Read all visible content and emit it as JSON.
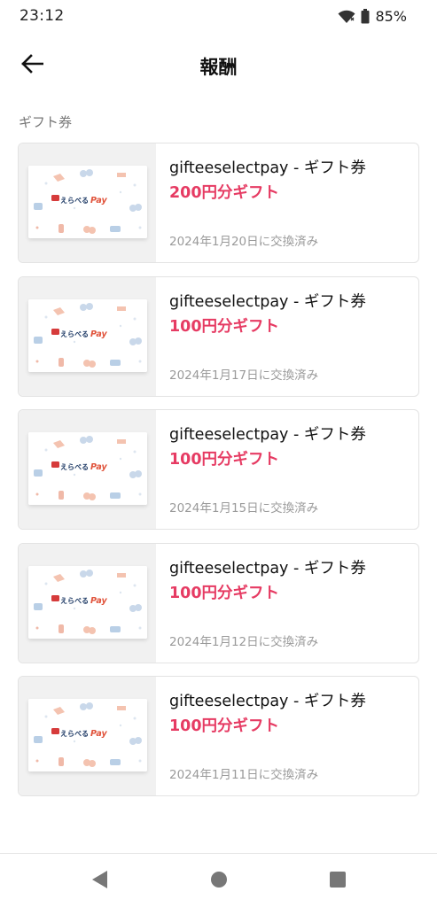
{
  "status_bar": {
    "time": "23:12",
    "battery": "85%"
  },
  "app_bar": {
    "title": "報酬"
  },
  "section": {
    "label": "ギフト券"
  },
  "gift_card_brand": {
    "jp": "えらべる",
    "pay": "Pay"
  },
  "items": [
    {
      "title": "gifteeselectpay - ギフト券",
      "amount": "200円分ギフト",
      "date": "2024年1月20日に交換済み"
    },
    {
      "title": "gifteeselectpay - ギフト券",
      "amount": "100円分ギフト",
      "date": "2024年1月17日に交換済み"
    },
    {
      "title": "gifteeselectpay - ギフト券",
      "amount": "100円分ギフト",
      "date": "2024年1月15日に交換済み"
    },
    {
      "title": "gifteeselectpay - ギフト券",
      "amount": "100円分ギフト",
      "date": "2024年1月12日に交換済み"
    },
    {
      "title": "gifteeselectpay - ギフト券",
      "amount": "100円分ギフト",
      "date": "2024年1月11日に交換済み"
    }
  ],
  "colors": {
    "accent": "#e63b63",
    "muted": "#9a9a9a",
    "border": "#e3e3e3"
  },
  "icons": {
    "back": "arrow-left-icon",
    "nav_back": "triangle-back-icon",
    "nav_home": "circle-home-icon",
    "nav_recents": "square-recents-icon"
  }
}
